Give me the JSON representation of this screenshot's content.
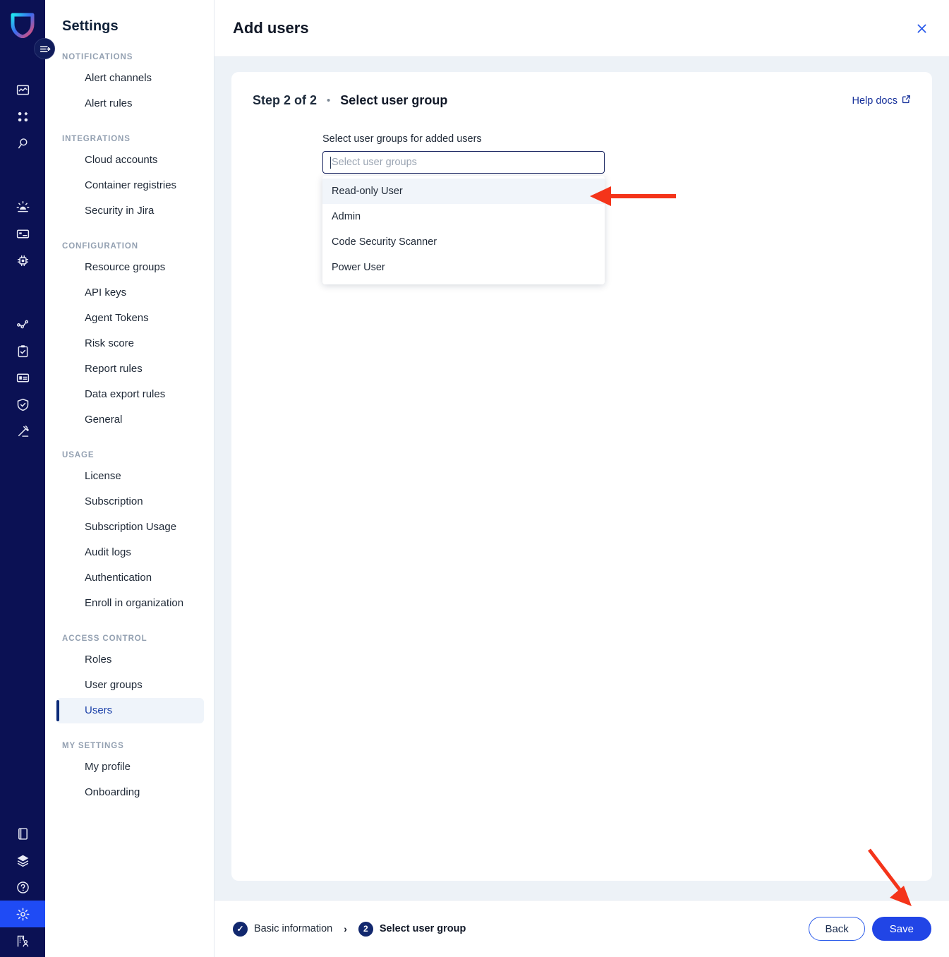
{
  "brand": {
    "logo_icon": "shield-logo-icon",
    "accent_blue": "#2145E6",
    "rail_bg": "#0B1154",
    "navy": "#12286E",
    "annotation_red": "#F4341A"
  },
  "rail": {
    "toggle_icon": "sidebar-toggle-icon",
    "items": [
      {
        "icon": "dashboard-chart-icon",
        "label": "Dashboard",
        "active": false
      },
      {
        "icon": "assets-grid-icon",
        "label": "Assets",
        "active": false
      },
      {
        "icon": "search-magnifier-icon",
        "label": "Search",
        "active": false
      },
      {
        "icon": "alerts-siren-icon",
        "label": "Alerts",
        "active": false
      },
      {
        "icon": "identity-card-icon",
        "label": "Identity",
        "active": false
      },
      {
        "icon": "chip-workload-icon",
        "label": "Workloads",
        "active": false
      },
      {
        "icon": "activity-graph-icon",
        "label": "Activity",
        "active": false
      },
      {
        "icon": "clipboard-check-icon",
        "label": "Tasks",
        "active": false
      },
      {
        "icon": "id-badge-icon",
        "label": "Records",
        "active": false
      },
      {
        "icon": "shield-check-icon",
        "label": "Compliance",
        "active": false
      },
      {
        "icon": "gavel-icon",
        "label": "Policies",
        "active": false
      }
    ],
    "bottom_items": [
      {
        "icon": "book-icon",
        "label": "Docs",
        "active": false
      },
      {
        "icon": "layers-icon",
        "label": "Layers",
        "active": false
      },
      {
        "icon": "help-circle-icon",
        "label": "Help",
        "active": false
      },
      {
        "icon": "gear-icon",
        "label": "Settings",
        "active": true
      },
      {
        "icon": "org-user-icon",
        "label": "Organization",
        "active": false
      }
    ]
  },
  "sidebar": {
    "title": "Settings",
    "groups": [
      {
        "title": "NOTIFICATIONS",
        "items": [
          {
            "label": "Alert channels",
            "active": false
          },
          {
            "label": "Alert rules",
            "active": false
          }
        ]
      },
      {
        "title": "INTEGRATIONS",
        "items": [
          {
            "label": "Cloud accounts",
            "active": false
          },
          {
            "label": "Container registries",
            "active": false
          },
          {
            "label": "Security in Jira",
            "active": false
          }
        ]
      },
      {
        "title": "CONFIGURATION",
        "items": [
          {
            "label": "Resource groups",
            "active": false
          },
          {
            "label": "API keys",
            "active": false
          },
          {
            "label": "Agent Tokens",
            "active": false
          },
          {
            "label": "Risk score",
            "active": false
          },
          {
            "label": "Report rules",
            "active": false
          },
          {
            "label": "Data export rules",
            "active": false
          },
          {
            "label": "General",
            "active": false
          }
        ]
      },
      {
        "title": "USAGE",
        "items": [
          {
            "label": "License",
            "active": false
          },
          {
            "label": "Subscription",
            "active": false
          },
          {
            "label": "Subscription Usage",
            "active": false
          },
          {
            "label": "Audit logs",
            "active": false
          },
          {
            "label": "Authentication",
            "active": false
          },
          {
            "label": "Enroll in organization",
            "active": false
          }
        ]
      },
      {
        "title": "ACCESS CONTROL",
        "items": [
          {
            "label": "Roles",
            "active": false
          },
          {
            "label": "User groups",
            "active": false
          },
          {
            "label": "Users",
            "active": true
          }
        ]
      },
      {
        "title": "MY SETTINGS",
        "items": [
          {
            "label": "My profile",
            "active": false
          },
          {
            "label": "Onboarding",
            "active": false
          }
        ]
      }
    ]
  },
  "header": {
    "title": "Add users",
    "close_icon": "close-icon"
  },
  "card": {
    "step_counter": "Step 2 of 2",
    "separator": "•",
    "step_title": "Select user group",
    "help_docs_label": "Help docs",
    "help_docs_icon": "external-link-icon"
  },
  "form": {
    "label": "Select user groups for added users",
    "input_value": "",
    "placeholder": "Select user groups",
    "options": [
      {
        "label": "Read-only User",
        "highlighted": true
      },
      {
        "label": "Admin",
        "highlighted": false
      },
      {
        "label": "Code Security Scanner",
        "highlighted": false
      },
      {
        "label": "Power User",
        "highlighted": false
      }
    ]
  },
  "footer": {
    "steps": [
      {
        "marker": "✓",
        "label": "Basic information",
        "current": false
      },
      {
        "marker": "2",
        "label": "Select user group",
        "current": true
      }
    ],
    "separator_icon": "chevron-right-icon",
    "back_label": "Back",
    "save_label": "Save"
  },
  "annotations": [
    {
      "name": "arrow-to-dropdown-option",
      "target": "Read-only User"
    },
    {
      "name": "arrow-to-save-button",
      "target": "Save"
    }
  ]
}
